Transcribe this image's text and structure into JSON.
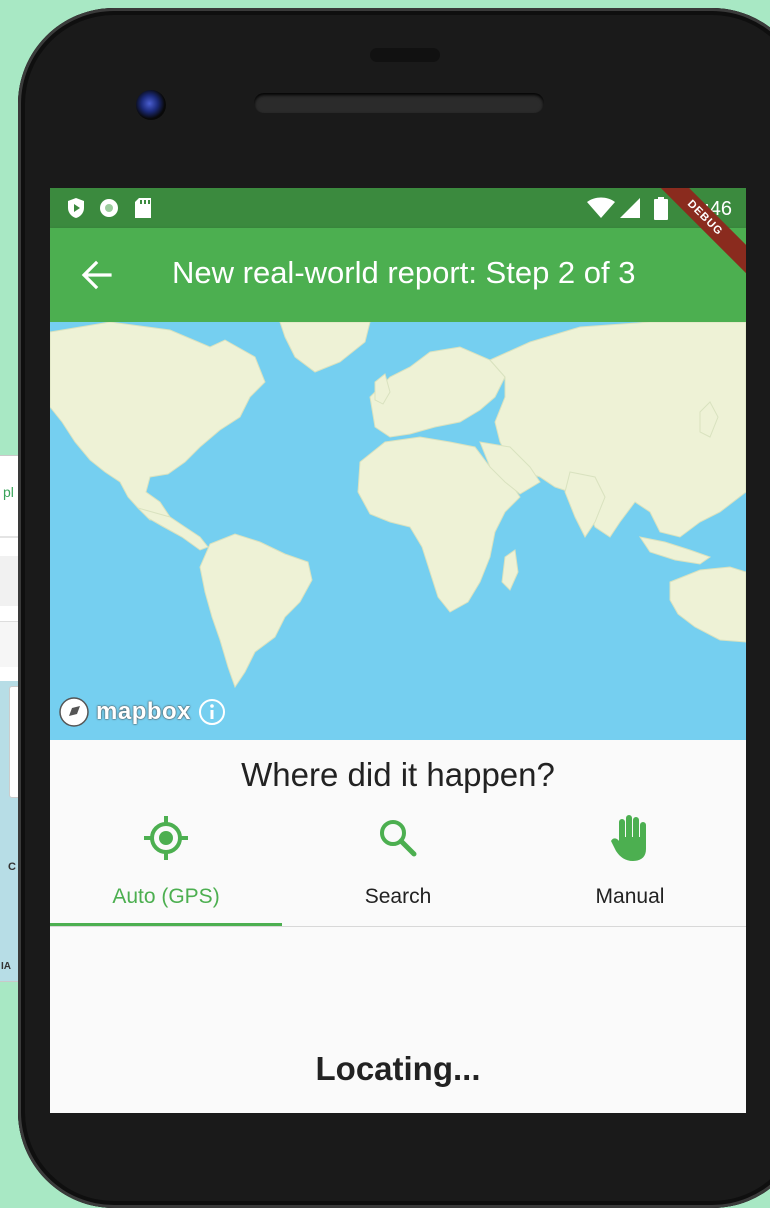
{
  "background_window": {
    "fragment_text": "pl",
    "fragment_c": "C",
    "fragment_ia": "IA"
  },
  "status_bar": {
    "time": "3:46",
    "icons": [
      "shield-icon",
      "circle-icon",
      "sd-card-icon",
      "wifi-icon",
      "signal-icon",
      "battery-icon"
    ]
  },
  "app_bar": {
    "title": "New real-world report: Step 2 of 3",
    "back_icon": "arrow-back-icon",
    "debug_banner": "DEBUG",
    "color": "#4caf50",
    "status_color": "#3b8a3e"
  },
  "map": {
    "attribution": "mapbox",
    "info_icon": "info-icon",
    "water_color": "#75cff0",
    "land_color": "#eef2d6"
  },
  "location": {
    "question": "Where did it happen?",
    "tabs": [
      {
        "label": "Auto (GPS)",
        "icon": "gps-target-icon",
        "selected": true
      },
      {
        "label": "Search",
        "icon": "search-icon",
        "selected": false
      },
      {
        "label": "Manual",
        "icon": "hand-icon",
        "selected": false
      }
    ],
    "status_text": "Locating..."
  }
}
